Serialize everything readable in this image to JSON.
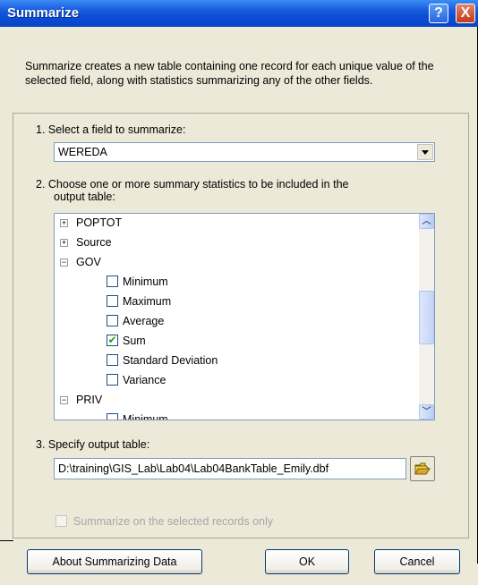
{
  "window": {
    "title": "Summarize"
  },
  "description": "Summarize creates a new table containing one record for each unique value of the selected field, along with statistics summarizing any of the other fields.",
  "step1": {
    "label": "1.  Select a field to summarize:",
    "selected_field": "WEREDA"
  },
  "step2": {
    "label_line1": "2.  Choose one or more summary statistics to be included in the",
    "label_line2": "output table:",
    "tree": [
      {
        "label": "POPTOT",
        "expander": "+"
      },
      {
        "label": "Source",
        "expander": "+"
      },
      {
        "label": "GOV",
        "expander": "−"
      },
      {
        "label": "Minimum",
        "checked": false
      },
      {
        "label": "Maximum",
        "checked": false
      },
      {
        "label": "Average",
        "checked": false
      },
      {
        "label": "Sum",
        "checked": true
      },
      {
        "label": "Standard Deviation",
        "checked": false
      },
      {
        "label": "Variance",
        "checked": false
      },
      {
        "label": "PRIV",
        "expander": "−"
      },
      {
        "label": "Minimum",
        "checked": false
      }
    ]
  },
  "step3": {
    "label": "3.  Specify output table:",
    "path": "D:\\training\\GIS_Lab\\Lab04\\Lab04BankTable_Emily.dbf"
  },
  "selected_only": {
    "label": "Summarize on the selected records only",
    "checked": false,
    "enabled": false
  },
  "buttons": {
    "about": "About Summarizing Data",
    "ok": "OK",
    "cancel": "Cancel"
  },
  "title_buttons": {
    "help": "?",
    "close": "X"
  },
  "colors": {
    "titlebar": "#0a4ed6",
    "dialog_bg": "#ece9d8",
    "check_mark": "#21a121"
  }
}
